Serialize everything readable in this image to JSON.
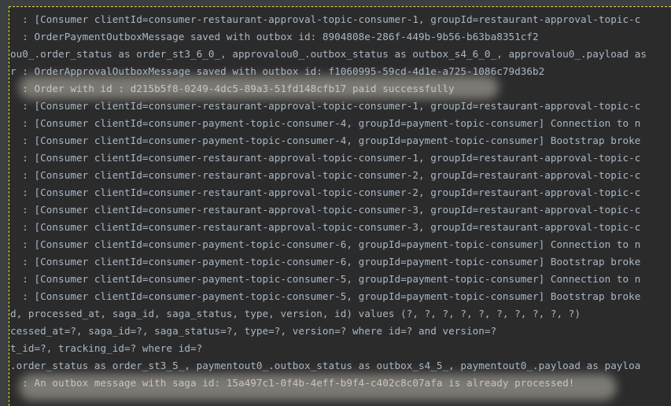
{
  "console": {
    "lines": [
      {
        "text": "  : [Consumer clientId=consumer-restaurant-approval-topic-consumer-1, groupId=restaurant-approval-topic-c",
        "highlighted": false
      },
      {
        "text": "  : OrderPaymentOutboxMessage saved with outbox id: 8904808e-286f-449b-9b56-b63ba8351cf2",
        "highlighted": false
      },
      {
        "text": "ou0_.order_status as order_st3_6_0_, approvalou0_.outbox_status as outbox_s4_6_0_, approvalou0_.payload as",
        "highlighted": false
      },
      {
        "text": "r : OrderApprovalOutboxMessage saved with outbox id: f1060995-59cd-4d1e-a725-1086c79d36b2",
        "highlighted": false
      },
      {
        "text": "  : Order with id : d215b5f8-0249-4dc5-89a3-51fd148cfb17 paid successfully",
        "highlighted": true
      },
      {
        "text": "  : [Consumer clientId=consumer-restaurant-approval-topic-consumer-1, groupId=restaurant-approval-topic-c",
        "highlighted": false
      },
      {
        "text": "  : [Consumer clientId=consumer-payment-topic-consumer-4, groupId=payment-topic-consumer] Connection to n",
        "highlighted": false
      },
      {
        "text": "  : [Consumer clientId=consumer-payment-topic-consumer-4, groupId=payment-topic-consumer] Bootstrap broke",
        "highlighted": false
      },
      {
        "text": "  : [Consumer clientId=consumer-restaurant-approval-topic-consumer-1, groupId=restaurant-approval-topic-c",
        "highlighted": false
      },
      {
        "text": "  : [Consumer clientId=consumer-restaurant-approval-topic-consumer-2, groupId=restaurant-approval-topic-c",
        "highlighted": false
      },
      {
        "text": "  : [Consumer clientId=consumer-restaurant-approval-topic-consumer-2, groupId=restaurant-approval-topic-c",
        "highlighted": false
      },
      {
        "text": "  : [Consumer clientId=consumer-restaurant-approval-topic-consumer-3, groupId=restaurant-approval-topic-c",
        "highlighted": false
      },
      {
        "text": "  : [Consumer clientId=consumer-restaurant-approval-topic-consumer-3, groupId=restaurant-approval-topic-c",
        "highlighted": false
      },
      {
        "text": "  : [Consumer clientId=consumer-payment-topic-consumer-6, groupId=payment-topic-consumer] Connection to n",
        "highlighted": false
      },
      {
        "text": "  : [Consumer clientId=consumer-payment-topic-consumer-6, groupId=payment-topic-consumer] Bootstrap broke",
        "highlighted": false
      },
      {
        "text": "  : [Consumer clientId=consumer-payment-topic-consumer-5, groupId=payment-topic-consumer] Connection to n",
        "highlighted": false
      },
      {
        "text": "  : [Consumer clientId=consumer-payment-topic-consumer-5, groupId=payment-topic-consumer] Bootstrap broke",
        "highlighted": false
      },
      {
        "text": "d, processed_at, saga_id, saga_status, type, version, id) values (?, ?, ?, ?, ?, ?, ?, ?, ?, ?)",
        "highlighted": false
      },
      {
        "text": "cessed_at=?, saga_id=?, saga_status=?, type=?, version=? where id=? and version=?",
        "highlighted": false
      },
      {
        "text": "t_id=?, tracking_id=? where id=?",
        "highlighted": false
      },
      {
        "text": ".order_status as order_st3_5_, paymentout0_.outbox_status as outbox_s4_5_, paymentout0_.payload as payloa",
        "highlighted": false
      },
      {
        "text": "  : An outbox message with saga id: 15a497c1-0f4b-4eff-b9f4-c402c8c07afa is already processed!",
        "highlighted": true
      }
    ]
  },
  "colors": {
    "background": "#2b2b2b",
    "text": "#a9b7c6",
    "selection_border": "#e6e600",
    "highlight": "#7c7a74"
  }
}
